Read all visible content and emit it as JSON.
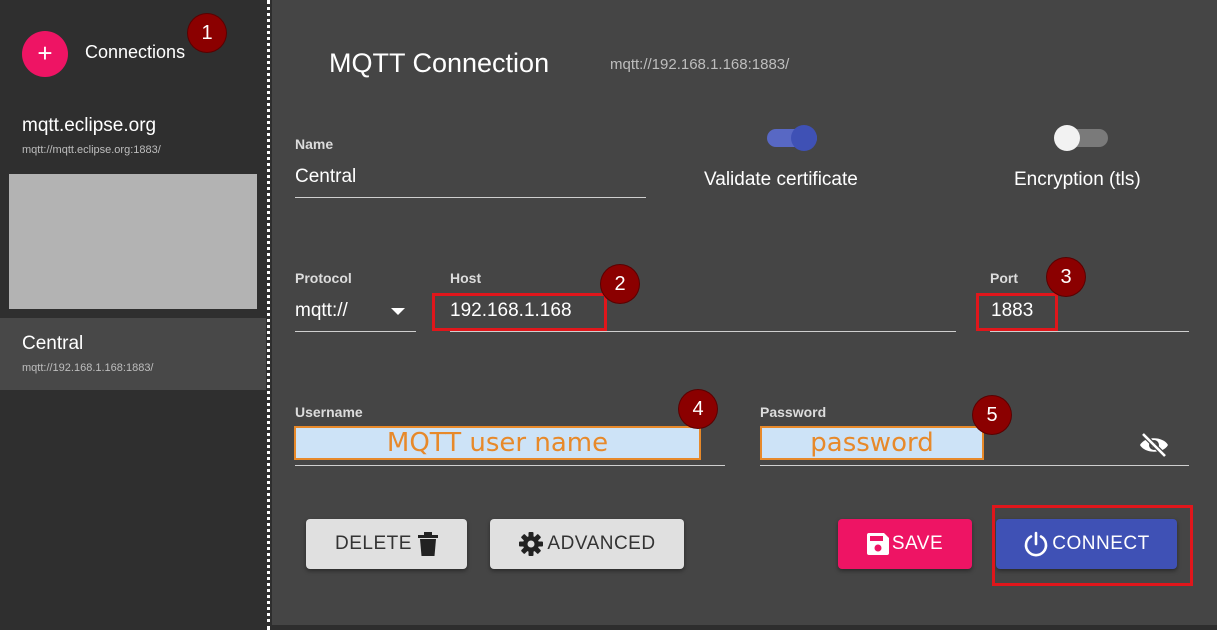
{
  "sidebar": {
    "add_icon": "plus-icon",
    "title": "Connections",
    "items": [
      {
        "name": "mqtt.eclipse.org",
        "url": "mqtt://mqtt.eclipse.org:1883/"
      },
      {
        "name": "Central",
        "url": "mqtt://192.168.1.168:1883/"
      }
    ]
  },
  "markers": [
    "1",
    "2",
    "3",
    "4",
    "5"
  ],
  "header": {
    "title": "MQTT Connection",
    "url": "mqtt://192.168.1.168:1883/"
  },
  "form": {
    "name_label": "Name",
    "name_value": "Central",
    "validate_label": "Validate certificate",
    "validate_on": true,
    "encryption_label": "Encryption (tls)",
    "encryption_on": false,
    "protocol_label": "Protocol",
    "protocol_value": "mqtt://",
    "host_label": "Host",
    "host_value": "192.168.1.168",
    "port_label": "Port",
    "port_value": "1883",
    "username_label": "Username",
    "username_placeholder": "MQTT user name",
    "password_label": "Password",
    "password_placeholder": "password",
    "visibility_icon": "eye-off-icon"
  },
  "buttons": {
    "delete": "DELETE",
    "advanced": "ADVANCED",
    "save": "SAVE",
    "connect": "CONNECT"
  },
  "colors": {
    "accent": "#ee1464",
    "primary": "#3f51b5",
    "annotation_red": "#e0161b",
    "annotation_marker": "#8b0000"
  }
}
